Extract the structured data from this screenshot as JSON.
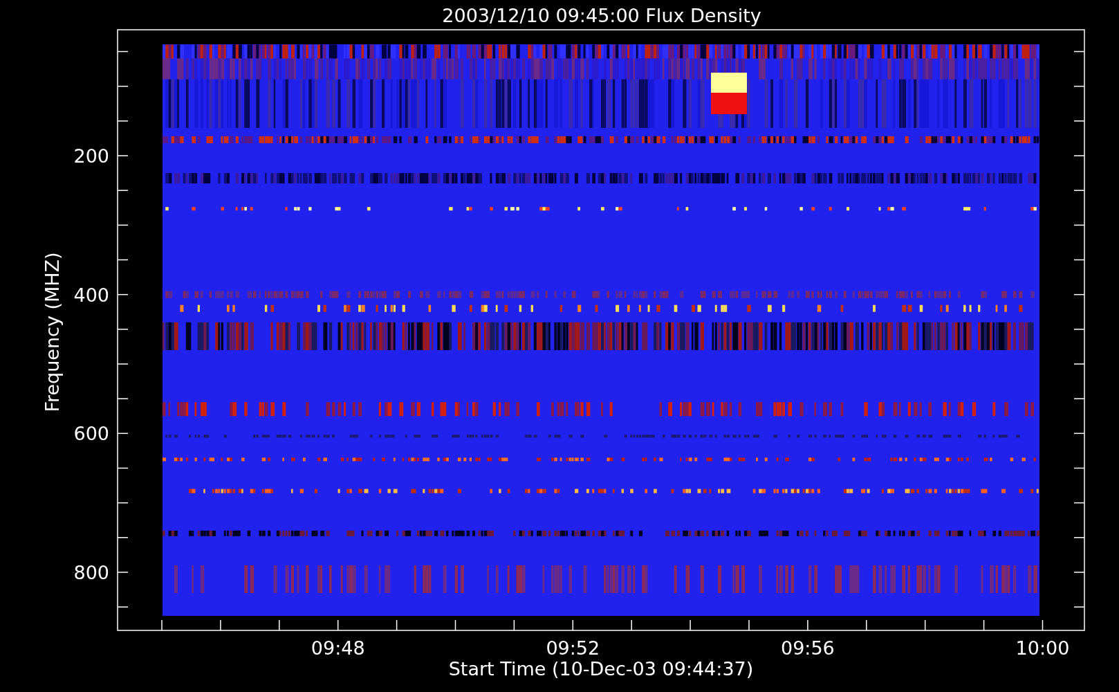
{
  "title": "2003/12/10 09:45:00 Flux Density",
  "chart": {
    "xlabel": "Start Time (10-Dec-03 09:44:37)",
    "ylabel": "Frequency (MHZ)",
    "yticks": [
      "200",
      "400",
      "600",
      "800"
    ],
    "xticks": [
      "09:48",
      "09:52",
      "09:56",
      "10:00"
    ]
  }
}
